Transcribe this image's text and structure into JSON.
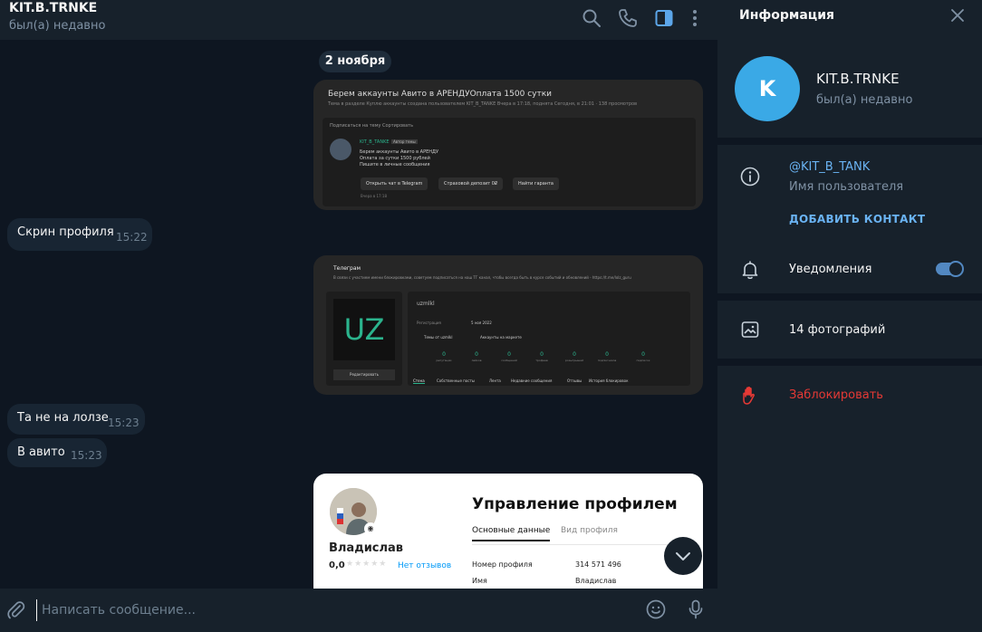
{
  "colors": {
    "accent": "#6ab3f3",
    "danger": "#e53935",
    "toggle": "#5288c1",
    "avatar": "#3aa9e6"
  },
  "chat": {
    "title": "KIT.B.TRNKE",
    "status": "был(а) недавно",
    "header_icons": [
      "search-icon",
      "phone-icon",
      "sidebar-toggle-icon",
      "more-vertical-icon"
    ],
    "date_separator": "2 ноября",
    "messages": [
      {
        "text": "Скрин профиля",
        "time": "15:22"
      },
      {
        "text": "Та не на лолзе",
        "time": "15:23"
      },
      {
        "text": "В авито",
        "time": "15:23"
      }
    ],
    "composer": {
      "placeholder": "Написать сообщение..."
    }
  },
  "photo1": {
    "title": "Берем аккаунты Авито в АРЕНДУОплата 1500 сутки",
    "meta": "Тема в разделе Куплю аккаунты создана пользователем KIT_B_TANKE Вчера в 17:18, поднята Сегодня, в 21:01 · 138 просмотров",
    "sort": "Подписаться на тему  Сортировать",
    "author": "KIT_B_TANKE",
    "author_badge": "Автор темы",
    "body": "Берем аккаунты Авито в АРЕНДУ Оплата за сутки 1500 рублей Пишите в личные сообщения",
    "posted": "Вчера в 17:18",
    "btn_telegram": "Открыть чат в Telegram",
    "btn_deposit": "Страховой депозит 0₽",
    "btn_garant": "Найти гаранта"
  },
  "photo2": {
    "tg_label": "Телеграм",
    "notice": "В связи с участием имени блокировками, советуем подписаться на наш ТГ канал, чтобы всегда быть в курсе событий и обновлений - https://t.me/lolz_guru",
    "logo": "UZ",
    "edit": "Редактировать",
    "username": "uzmlkl",
    "reg_label": "Регистрация",
    "reg_value": "5 ноя 2022",
    "link_themes": "Темы от uzmlkl",
    "link_market": "Аккаунты на маркете",
    "stats": [
      {
        "value": "0",
        "label": "репутации"
      },
      {
        "value": "0",
        "label": "лайков"
      },
      {
        "value": "0",
        "label": "сообщений"
      },
      {
        "value": "0",
        "label": "трофеев"
      },
      {
        "value": "0",
        "label": "розыгрышей"
      },
      {
        "value": "0",
        "label": "подписчиков"
      },
      {
        "value": "0",
        "label": "подписок"
      }
    ],
    "tabs": [
      "Стена",
      "Собственные посты",
      "Лента",
      "Недавние сообщения",
      "Отзывы",
      "История блокировок"
    ]
  },
  "photo3": {
    "name": "Владислав",
    "rating": "0,0",
    "stars": "★★★★★",
    "reviews": "Нет отзывов",
    "title": "Управление профилем",
    "tab_main": "Основные данные",
    "tab_view": "Вид профиля",
    "row1_label": "Номер профиля",
    "row1_value": "314 571 496",
    "row2_label": "Имя",
    "row2_value": "Владислав"
  },
  "info": {
    "title": "Информация",
    "avatar_letter": "K",
    "name": "KIT.B.TRNKE",
    "status": "был(а) недавно",
    "username": "@KIT_B_TANK",
    "username_label": "Имя пользователя",
    "add_contact": "ДОБАВИТЬ КОНТАКТ",
    "notifications": "Уведомления",
    "notifications_on": true,
    "photos": "14 фотографий",
    "block": "Заблокировать"
  }
}
